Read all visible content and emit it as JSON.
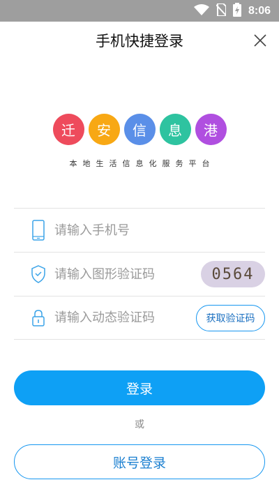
{
  "status_bar": {
    "time": "8:06",
    "icons": [
      "wifi-icon",
      "no-sim-icon",
      "battery-charging-icon"
    ]
  },
  "header": {
    "title": "手机快捷登录",
    "close_icon": "close-icon"
  },
  "brand": {
    "logo_chars": [
      {
        "char": "迁",
        "color": "#ee4b5c"
      },
      {
        "char": "安",
        "color": "#f8a814"
      },
      {
        "char": "信",
        "color": "#5a8fe8"
      },
      {
        "char": "息",
        "color": "#2ec3a0"
      },
      {
        "char": "港",
        "color": "#b04fe0"
      }
    ],
    "tagline": "本地生活信息化服务平台"
  },
  "form": {
    "phone_placeholder": "请输入手机号",
    "captcha_placeholder": "请输入图形验证码",
    "captcha_code": "0564",
    "sms_placeholder": "请输入动态验证码",
    "get_code_label": "获取验证码"
  },
  "actions": {
    "login_label": "登录",
    "or_label": "或",
    "account_login_label": "账号登录"
  },
  "colors": {
    "accent": "#0ea0f5",
    "statusbar": "#9e9e9e"
  }
}
